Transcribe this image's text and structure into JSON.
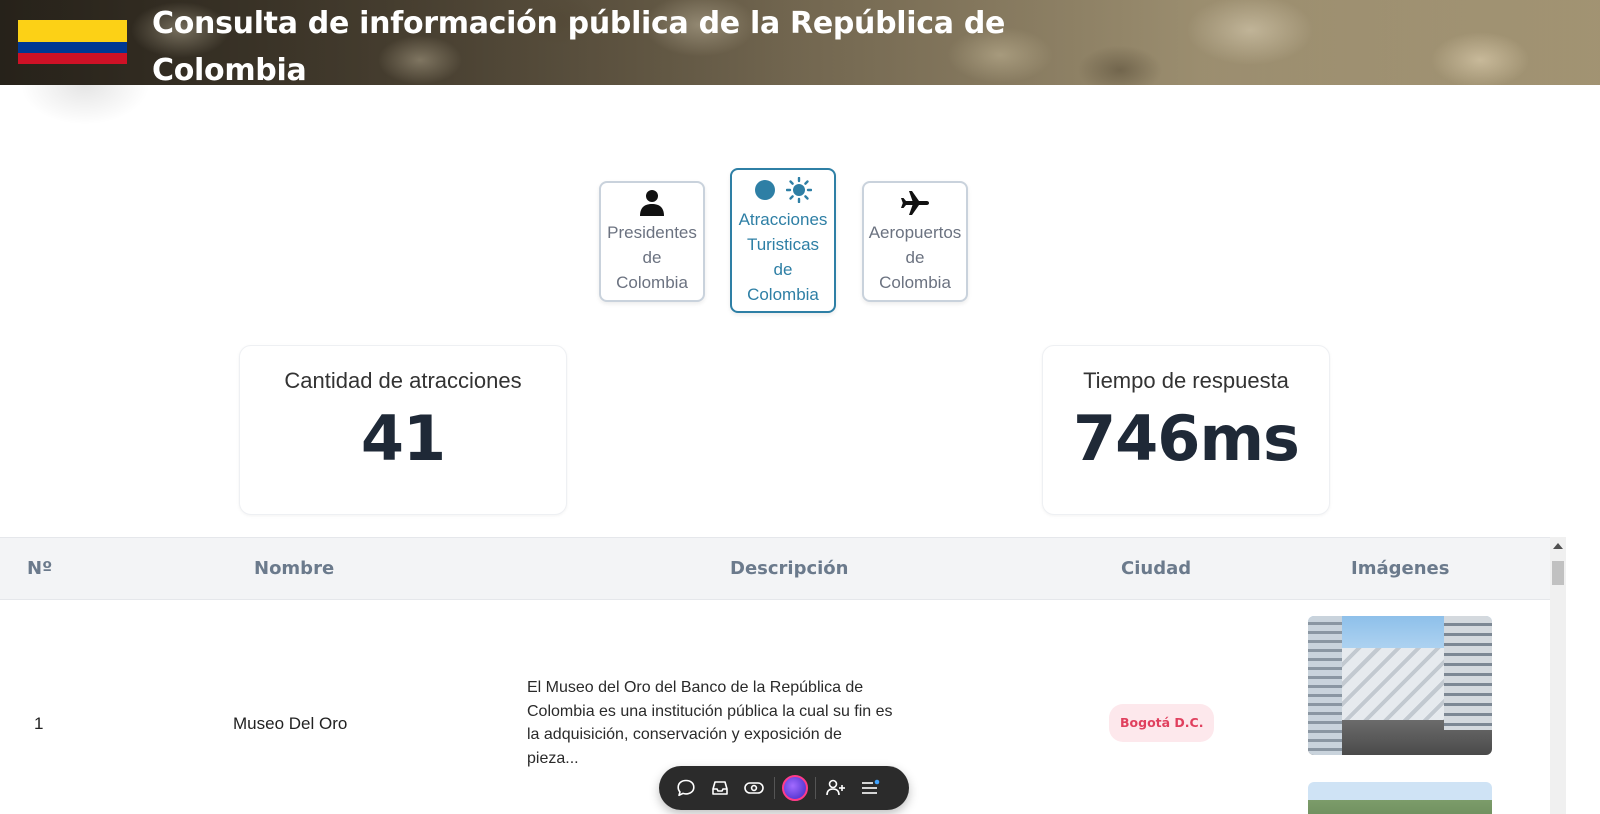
{
  "header": {
    "title": "Consulta de información pública de la República de Colombia",
    "flag_colors": [
      "#fcd116",
      "#003893",
      "#ce1126"
    ]
  },
  "tabs": [
    {
      "label": "Presidentes\nde\nColombia",
      "icon": "person-icon",
      "active": false
    },
    {
      "label": "Atracciones\nTuristicas\nde\nColombia",
      "icon": "sun-icon",
      "active": true
    },
    {
      "label": "Aeropuertos\nde\nColombia",
      "icon": "airplane-icon",
      "active": false
    }
  ],
  "stats": {
    "attractions_label": "Cantidad de atracciones",
    "attractions_value": "41",
    "response_label": "Tiempo de respuesta",
    "response_value": "746ms"
  },
  "table": {
    "columns": [
      "Nº",
      "Nombre",
      "Descripción",
      "Ciudad",
      "Imágenes"
    ],
    "rows": [
      {
        "number": "1",
        "name": "Museo Del Oro",
        "description": "El Museo del Oro del Banco de la República de Colombia es una institución pública la cual su fin es la adquisición, conservación y exposición de pieza...",
        "city": "Bogotá D.C.",
        "image": "museo-del-oro-photo"
      },
      {
        "number": "",
        "name": "",
        "description": "",
        "city": "",
        "image": "landscape-photo"
      }
    ]
  },
  "toolbar": {
    "items": [
      "chat-icon",
      "inbox-icon",
      "eye-icon",
      "assistant-orb-icon",
      "add-user-icon",
      "menu-icon"
    ]
  },
  "colors": {
    "accent": "#2e7fa5",
    "badge_bg": "#fde8ec",
    "badge_text": "#e0405e",
    "header_col_text": "#6b7a8c"
  }
}
